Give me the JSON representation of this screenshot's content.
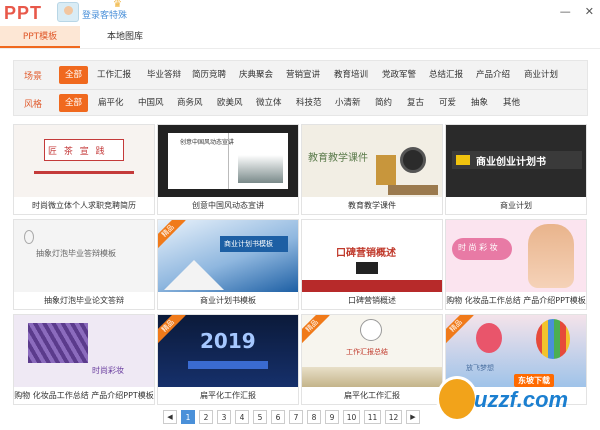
{
  "app": {
    "logo": "PPT",
    "login_label": "登录客特殊",
    "crown_icon": "crown-icon"
  },
  "window": {
    "minimize": "—",
    "close": "✕"
  },
  "tabs": {
    "ppt_templates": "PPT模板",
    "local_gallery": "本地图库"
  },
  "filters": {
    "scene_label": "场景",
    "scene_options": [
      "全部",
      "工作汇报",
      "毕业答辩",
      "简历竞聘",
      "庆典聚会",
      "营销宣讲",
      "教育培训",
      "党政军警",
      "总结汇报",
      "产品介绍",
      "商业计划"
    ],
    "style_label": "风格",
    "style_options": [
      "全部",
      "扁平化",
      "中国风",
      "商务风",
      "欧美风",
      "微立体",
      "科技范",
      "小清新",
      "简约",
      "复古",
      "可爱",
      "抽象",
      "其他"
    ]
  },
  "cards": [
    {
      "caption": "时尚微立体个人求职竞聘简历",
      "thumb_title": "匠 茶 宣 践",
      "badge": ""
    },
    {
      "caption": "创意中国风动态宣讲",
      "thumb_title": "创意中国风动态宣讲",
      "badge": ""
    },
    {
      "caption": "教育教学课件",
      "thumb_title": "教育教学课件",
      "badge": ""
    },
    {
      "caption": "商业计划",
      "thumb_title": "商业创业计划书",
      "badge": ""
    },
    {
      "caption": "抽象灯泡毕业论文答辩",
      "thumb_title": "抽象灯泡毕业答辩模板",
      "badge": ""
    },
    {
      "caption": "商业计划书模板",
      "thumb_title": "商业计划书模板",
      "badge": "精品"
    },
    {
      "caption": "口碑营销概述",
      "thumb_title": "口碑营销概述",
      "badge": ""
    },
    {
      "caption": "购物 化妆品工作总结 产品介绍PPT模板",
      "thumb_title": "时 尚 彩 妆",
      "badge": ""
    },
    {
      "caption": "购物 化妆品工作总结 产品介绍PPT模板",
      "thumb_title": "时尚彩妆",
      "badge": ""
    },
    {
      "caption": "扁平化工作汇报",
      "thumb_title": "2019",
      "badge": "精品"
    },
    {
      "caption": "扁平化工作汇报",
      "thumb_title": "工作汇报总结",
      "badge": "精品"
    },
    {
      "caption": "",
      "thumb_title": "放飞梦想",
      "badge": "精品"
    }
  ],
  "pagination": {
    "prev": "◀",
    "next": "▶",
    "pages": [
      "1",
      "2",
      "3",
      "4",
      "5",
      "6",
      "7",
      "8",
      "9",
      "10",
      "11",
      "12"
    ],
    "current": "1"
  },
  "watermark": {
    "text": "uzzf.com",
    "tag": "东坡下载"
  },
  "colors": {
    "accent": "#f0691e",
    "link": "#4a90d9"
  }
}
